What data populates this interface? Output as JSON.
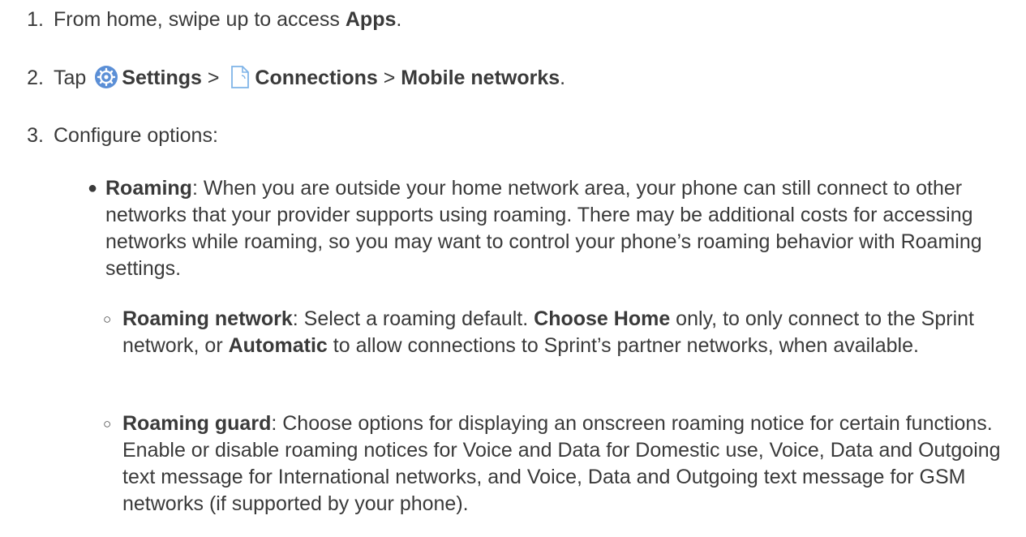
{
  "steps": [
    {
      "num": "1.",
      "pre": "From home, swipe up to access ",
      "bold": "Apps",
      "post": "."
    },
    {
      "num": "2.",
      "pre": "Tap ",
      "settings": "Settings",
      "sep1": " > ",
      "connections": "Connections",
      "sep2": " > ",
      "mobile": "Mobile networks",
      "post": "."
    },
    {
      "num": "3.",
      "text": "Configure options:"
    }
  ],
  "roaming": {
    "bold": "Roaming",
    "text": ": When you are outside your home network area, your phone can still connect to other networks that your provider supports using roaming. There may be additional costs for accessing networks while roaming, so you may want to control your phone’s roaming behavior with Roaming settings."
  },
  "roaming_network": {
    "bold": "Roaming network",
    "t1": ": Select a roaming default. ",
    "b2": "Choose Home",
    "t2": " only, to only connect to the Sprint network, or ",
    "b3": "Automatic",
    "t3": " to allow connections to Sprint’s partner networks, when available."
  },
  "roaming_guard": {
    "bold": "Roaming guard",
    "text": ": Choose options for displaying an onscreen roaming notice for certain functions. Enable or disable roaming notices for Voice and Data for Domestic use, Voice, Data and Outgoing text message for International networks, and Voice, Data and Outgoing text message for GSM networks (if supported by your phone)."
  },
  "icons": {
    "settings": "settings-gear-icon",
    "connections": "connections-icon"
  },
  "colors": {
    "text": "#3a3a3a",
    "settings_icon": "#5b8fd6",
    "connections_icon": "#7fb4e8"
  }
}
